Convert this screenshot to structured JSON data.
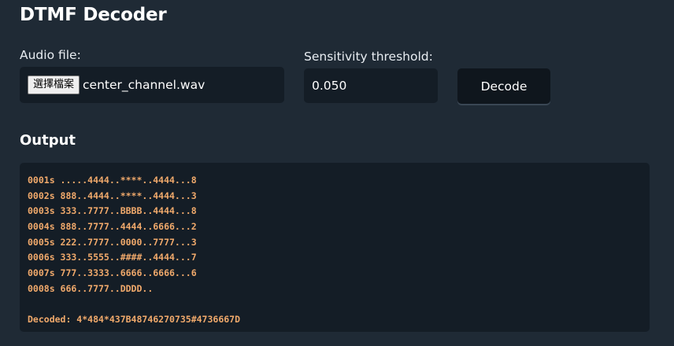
{
  "app": {
    "title": "DTMF Decoder"
  },
  "file_input": {
    "label": "Audio file:",
    "button_label": "選擇檔案",
    "file_name": "center_channel.wav"
  },
  "threshold": {
    "label": "Sensitivity threshold:",
    "value": "0.050"
  },
  "decode_button": {
    "label": "Decode"
  },
  "output": {
    "title": "Output",
    "lines": [
      "0001s .....4444..****..4444...8",
      "0002s 888..4444..****..4444...3",
      "0003s 333..7777..BBBB..4444...8",
      "0004s 888..7777..4444..6666...2",
      "0005s 222..7777..0000..7777...3",
      "0006s 333..5555..####..4444...7",
      "0007s 777..3333..6666..6666...6",
      "0008s 666..7777..DDDD.."
    ],
    "decoded": "Decoded: 4*484*437B48746270735#4736667D"
  },
  "colors": {
    "background": "#1f2a35",
    "panel": "#141d26",
    "button": "#0f161d",
    "output_text": "#f0a96b"
  }
}
